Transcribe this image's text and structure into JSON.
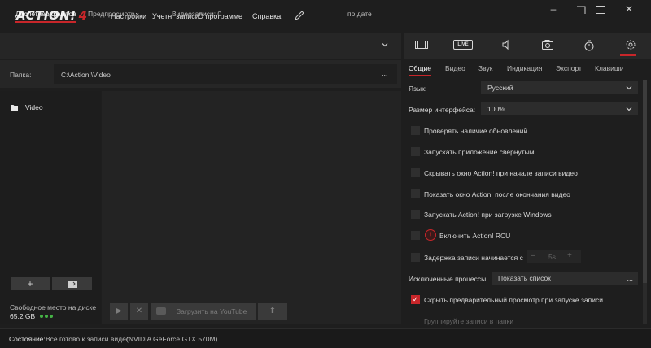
{
  "app": {
    "logo_text": "ACTION!",
    "logo_version": "4"
  },
  "menu": [
    "Настройки",
    "Учетн. записи",
    "О программе",
    "Справка"
  ],
  "window_controls": {
    "minimize": "–",
    "restore": "▢",
    "close": "✕"
  },
  "left": {
    "tabs": [
      "Диспетчер файлов",
      "Предпросмотр"
    ],
    "recordings_label": "Видеозаписи: 0",
    "sort_label": "по дате",
    "folder_label": "Папка:",
    "folder_path": "C:\\Action!\\Video",
    "folder_browse": "...",
    "tree_items": [
      "Video"
    ],
    "add_button": "+",
    "disk_label": "Свободное место на диске",
    "disk_value": "65.2 GB",
    "toolbar": {
      "play": "▶",
      "delete": "✕",
      "upload_youtube": "Загрузить на YouTube",
      "upload": "⬆"
    }
  },
  "status": {
    "label": "Состояние:",
    "text": "Все готово к записи видео...",
    "gpu": "(NVIDIA GeForce GTX 570M)"
  },
  "right": {
    "icon_row": [
      "film-icon",
      "live-icon",
      "speaker-icon",
      "camera-icon",
      "timer-icon",
      "gear-icon"
    ],
    "live_text": "LIVE",
    "tabs": [
      "Общие",
      "Видео",
      "Звук",
      "Индикация",
      "Экспорт",
      "Клавиши"
    ],
    "language_label": "Язык:",
    "language_value": "Русский",
    "ui_size_label": "Размер интерфейса:",
    "ui_size_value": "100%",
    "checkboxes": [
      {
        "label": "Проверять наличие обновлений",
        "checked": false
      },
      {
        "label": "Запускать приложение свернутым",
        "checked": false
      },
      {
        "label": "Скрывать окно Action! при начале записи видео",
        "checked": false
      },
      {
        "label": "Показать окно Action! после окончания видео",
        "checked": false
      },
      {
        "label": "Запускать Action! при загрузке Windows",
        "checked": false
      },
      {
        "label": "Включить Action! RCU",
        "checked": false
      },
      {
        "label": "Задержка записи начинается с",
        "checked": false
      }
    ],
    "delay_minus": "–",
    "delay_value": "5s",
    "delay_plus": "+",
    "excluded_label": "Исключенные процессы:",
    "excluded_value": "Показать список",
    "excluded_browse": "...",
    "hide_preview": {
      "label": "Скрыть предварительный просмотр при запуске записи",
      "checked": true
    },
    "group_label": "Группируйте записи в папки"
  },
  "colors": {
    "accent": "#c8262a",
    "bg": "#1e1e1e",
    "panel": "#262626"
  }
}
